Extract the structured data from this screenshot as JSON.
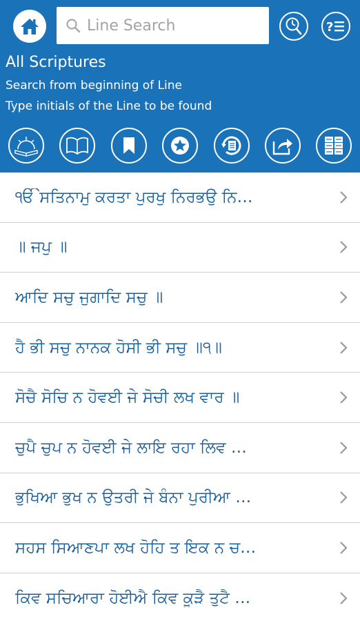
{
  "header": {
    "search_placeholder": "Line Search",
    "title": "All Scriptures",
    "subtitle_1": "Search from beginning of Line",
    "subtitle_2": "Type initials of the Line to be found",
    "accent_color": "#1a72b8"
  },
  "icons": {
    "home": "home-icon",
    "search": "search-icon",
    "history": "history-search-icon",
    "help": "help-list-icon",
    "toolbar": [
      "scripture-sunrise-icon",
      "open-book-icon",
      "bookmark-icon",
      "star-icon",
      "history-list-icon",
      "share-icon",
      "grid-menu-icon"
    ]
  },
  "lines": [
    "ੴ ਸਤਿਨਾਮੁ ਕਰਤਾ ਪੁਰਖੁ ਨਿਰਭਉ ਨਿ…",
    "॥ ਜਪੁ ॥",
    "ਆਦਿ ਸਚੁ  ਜੁਗਾਦਿ ਸਚੁ ॥",
    "ਹੈ ਭੀ ਸਚੁ ਨਾਨਕ  ਹੋਸੀ ਭੀ ਸਚੁ ॥੧॥",
    "ਸੋਚੈ  ਸੋਚਿ ਨ ਹੋਵਈ ਜੇ ਸੋਚੀ ਲਖ ਵਾਰ ॥",
    "ਚੁਪੈ  ਚੁਪ ਨ ਹੋਵਈ ਜੇ ਲਾਇ ਰਹਾ ਲਿਵ …",
    "ਭੁਖਿਆ  ਭੁਖ ਨ ਉਤਰੀ ਜੇ ਬੰਨਾ ਪੁਰੀਆ …",
    "ਸਹਸ ਸਿਆਣਪਾ ਲਖ ਹੋਹਿ ਤ ਇਕ ਨ ਚ…",
    "ਕਿਵ ਸਚਿਆਰਾ ਹੋਈਐ ਕਿਵ ਕੂੜੈ ਤੁਟੈ …"
  ]
}
